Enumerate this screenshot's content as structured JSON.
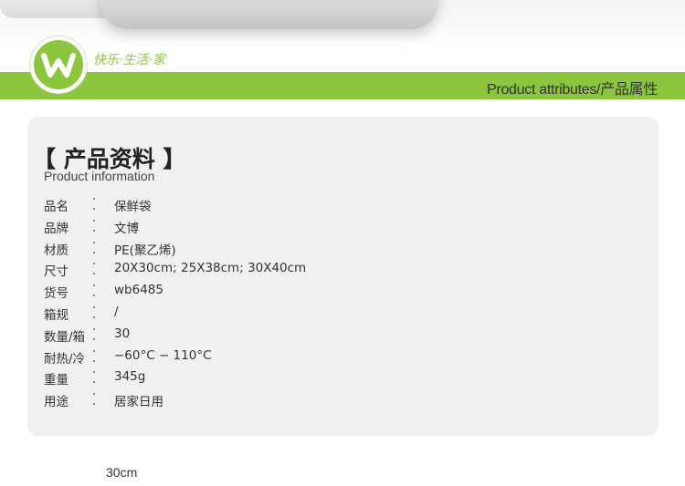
{
  "header": {
    "slogan": "快乐·生活·家",
    "band_title": "Product attributes/产品属性",
    "logo_letter": "W",
    "brand_green": "#8cc63f"
  },
  "card": {
    "title": "【 产品资料 】",
    "subtitle": "Product information",
    "rows": [
      {
        "label": "品名",
        "value": "保鲜袋"
      },
      {
        "label": "品牌",
        "value": "文博"
      },
      {
        "label": "材质",
        "value": "PE(聚乙烯)"
      },
      {
        "label": "尺寸",
        "value": "20X30cm; 25X38cm;  30X40cm"
      },
      {
        "label": "货号",
        "value": "wb6485"
      },
      {
        "label": "箱规",
        "value": "/"
      },
      {
        "label": "数量/箱",
        "value": "30"
      },
      {
        "label": "耐热/冷",
        "value": "−60°C − 110°C"
      },
      {
        "label": "重量",
        "value": "345g"
      },
      {
        "label": "用途",
        "value": "居家日用"
      }
    ]
  },
  "footer": {
    "note": "30cm"
  }
}
